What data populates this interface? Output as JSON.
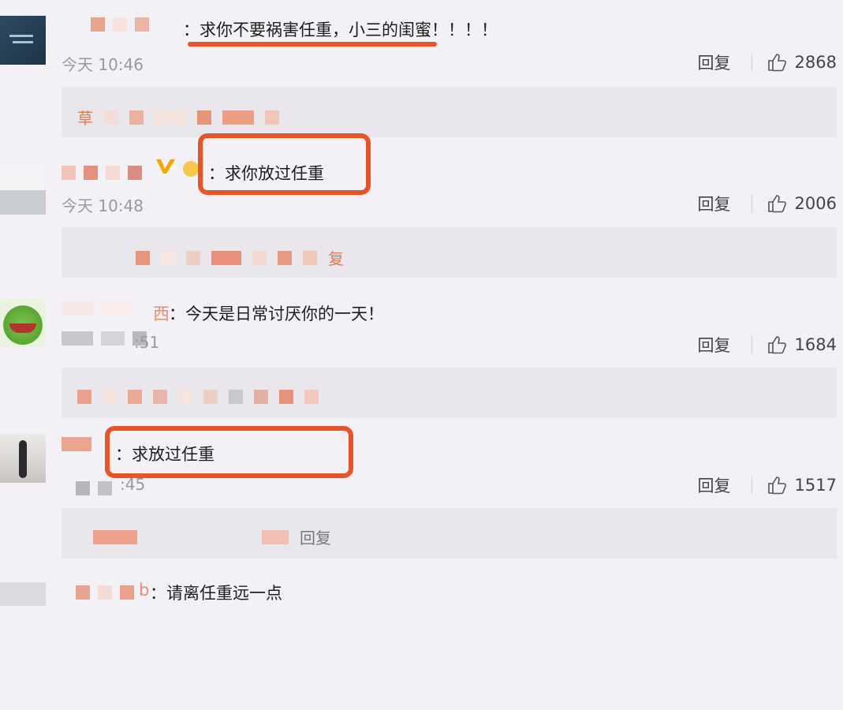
{
  "comments": [
    {
      "text": "：求你不要祸害任重，小三的闺蜜！！！！",
      "time": "今天 10:46",
      "reply": "回复",
      "likes": "2868",
      "reply_preview": "草"
    },
    {
      "text": "：求你放过任重",
      "time": "今天 10:48",
      "reply": "回复",
      "likes": "2006",
      "reply_preview": "复"
    },
    {
      "name_tail": "西",
      "text": "：今天是日常讨厌你的一天！",
      "time": ":51",
      "reply": "回复",
      "likes": "1684"
    },
    {
      "text": "：求放过任重",
      "time": ":45",
      "reply": "回复",
      "likes": "1517",
      "reply_preview": "回复"
    },
    {
      "name_tail": "b",
      "text": "：请离任重远一点"
    }
  ],
  "colors": {
    "highlight": "#e8542a",
    "background": "#f3f1f6",
    "reply_bg": "#e9e6ec"
  },
  "icons": {
    "like": "thumbs-up-icon",
    "verified": "verified-v-icon"
  }
}
